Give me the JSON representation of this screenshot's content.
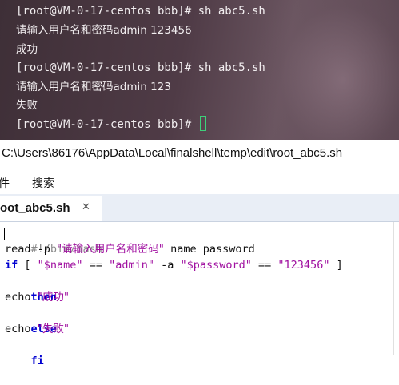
{
  "terminal": {
    "lines": [
      "[root@VM-0-17-centos bbb]# sh abc5.sh",
      "请输入用户名和密码admin 123456",
      "成功",
      "[root@VM-0-17-centos bbb]# sh abc5.sh",
      "请输入用户名和密码admin 123",
      "失败",
      "[root@VM-0-17-centos bbb]# "
    ]
  },
  "editor_window": {
    "path": "C:\\Users\\86176\\AppData\\Local\\finalshell\\temp\\edit\\root_abc5.sh",
    "menu": [
      "件",
      "搜索"
    ],
    "tab": {
      "label": "oot_abc5.sh",
      "close": "✕"
    },
    "code": {
      "l1": "#!/bin/bash",
      "l2_a": "read -p ",
      "l2_b": "\"请输入用户名和密码\"",
      "l2_c": " name password",
      "l3_if": "if",
      "l3_a": " [ ",
      "l3_b": "\"$name\"",
      "l3_c": " == ",
      "l3_d": "\"admin\"",
      "l3_e": " -a ",
      "l3_f": "\"$password\"",
      "l3_g": " == ",
      "l3_h": "\"123456\"",
      "l3_i": " ]",
      "l4": "then",
      "l5_a": "echo ",
      "l5_b": "\"成功\"",
      "l6": "else",
      "l7_a": "echo ",
      "l7_b": "\"失败\"",
      "l8": "fi"
    }
  },
  "colors": {
    "keyword": "#0000d0",
    "string": "#a010a0",
    "comment": "#8a8a8a",
    "cursor": "#3ed07a"
  }
}
